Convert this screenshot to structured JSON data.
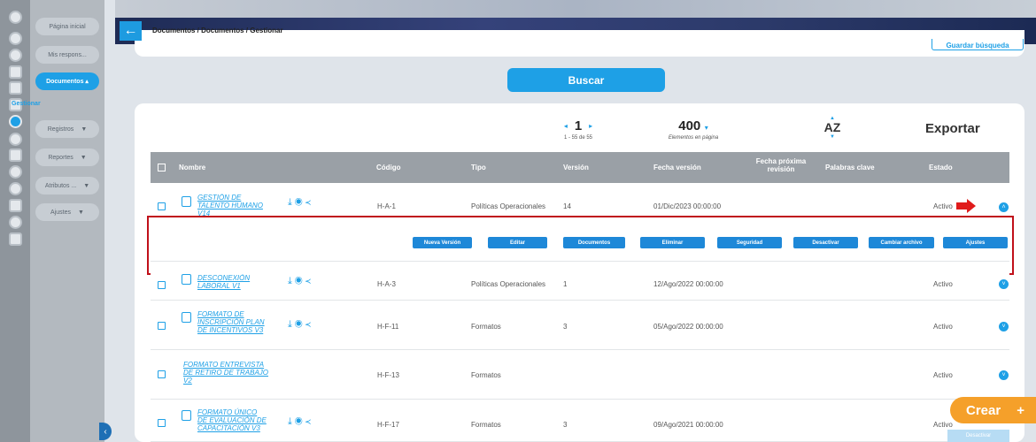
{
  "sidebar": {
    "items": [
      {
        "label": "Página inicial"
      },
      {
        "label": "Mis respons..."
      },
      {
        "label": "Documentos ▴"
      },
      {
        "label": "Registros"
      },
      {
        "label": "Reportes"
      },
      {
        "label": "Atributos ..."
      },
      {
        "label": "Ajustes"
      }
    ],
    "sub_item": "Gestionar",
    "rail_icons": [
      "settings-icon",
      "check-icon",
      "user-icon",
      "chart-icon",
      "book-icon",
      "trophy-icon",
      "document-icon",
      "clock-icon",
      "sliders-icon",
      "warning-icon",
      "globe-icon",
      "server-icon",
      "globe-alt-icon",
      "folder-icon"
    ]
  },
  "header": {
    "back_icon": "arrow-left-icon",
    "breadcrumb": "Documentos / Documentos / Gestionar",
    "save_search": "Guardar búsqueda"
  },
  "search": {
    "button": "Buscar"
  },
  "toolbar": {
    "page": "1",
    "page_range": "1 - 55 de 55",
    "per_page": "400",
    "per_page_caret": "▾",
    "per_page_label": "Elementos en página",
    "sort_label": "AZ",
    "export": "Exportar"
  },
  "table": {
    "columns": [
      "Nombre",
      "Código",
      "Tipo",
      "Versión",
      "Fecha versión",
      "Fecha próxima revisión",
      "Palabras clave",
      "Estado"
    ],
    "rows": [
      {
        "name": "GESTIÓN DE TALENTO HUMANO V14",
        "code": "H-A-1",
        "type": "Políticas Operacionales",
        "version": "14",
        "date": "01/Dic/2023 00:00:00",
        "status": "Activo"
      },
      {
        "name": "DESCONEXIÓN LABORAL V1",
        "code": "H-A-3",
        "type": "Políticas Operacionales",
        "version": "1",
        "date": "12/Ago/2022 00:00:00",
        "status": "Activo"
      },
      {
        "name": "FORMATO DE INSCRIPCIÓN PLAN DE INCENTIVOS V3",
        "code": "H-F-11",
        "type": "Formatos",
        "version": "3",
        "date": "05/Ago/2022 00:00:00",
        "status": "Activo"
      },
      {
        "name": "FORMATO ENTREVISTA DE RETIRO DE TRABAJO V2",
        "code": "H-F-13",
        "type": "Formatos",
        "version": "",
        "date": "",
        "status": "Activo"
      },
      {
        "name": "FORMATO ÚNICO DE EVALUACIÓN DE CAPACITACIÓN V3",
        "code": "H-F-17",
        "type": "Formatos",
        "version": "3",
        "date": "09/Ago/2021 00:00:00",
        "status": "Activo"
      }
    ],
    "row_actions": [
      "download-icon",
      "eye-icon",
      "share-icon"
    ]
  },
  "actions": [
    "Nueva Versión",
    "Editar",
    "Documentos",
    "Eliminar",
    "Seguridad",
    "Desactivar",
    "Cambiar archivo",
    "Ajustes"
  ],
  "fab": {
    "label": "Crear",
    "plus": "+"
  },
  "bottom_button": "Desactivar",
  "colors": {
    "accent": "#1ea0e6",
    "highlight_box": "#c0101a",
    "fab": "#f5a02a"
  }
}
